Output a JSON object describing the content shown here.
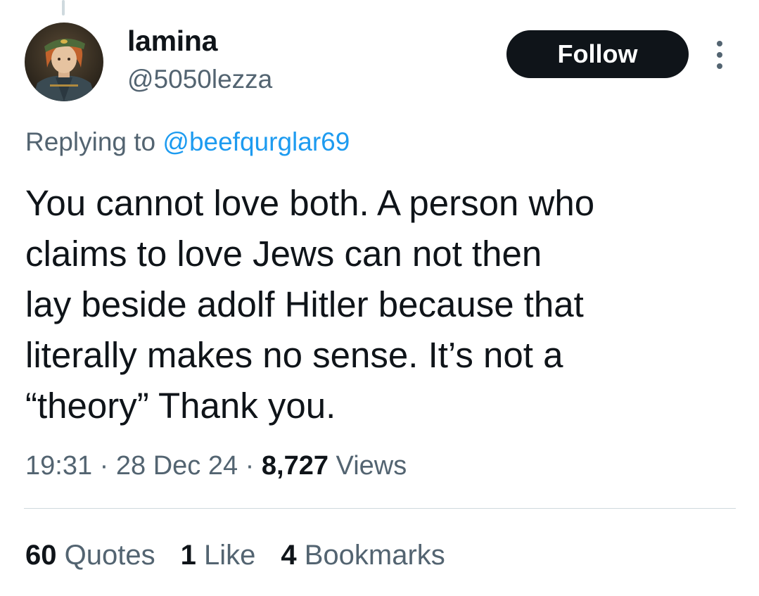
{
  "author": {
    "display_name": "lamina",
    "handle": "@5050lezza"
  },
  "follow_label": "Follow",
  "reply": {
    "prefix": "Replying to",
    "to_handle": "@beefqurglar69"
  },
  "tweet": {
    "lines": [
      "You cannot love both. A person who",
      "claims to love Jews can not then",
      "lay beside adolf Hitler because that",
      "literally makes no sense. It’s not a",
      "“theory” Thank you."
    ]
  },
  "meta": {
    "time": "19:31",
    "separator": "·",
    "date": "28 Dec 24",
    "views_count": "8,727",
    "views_label": "Views"
  },
  "stats": {
    "quotes_count": "60",
    "quotes_label": "Quotes",
    "likes_count": "1",
    "likes_label": "Like",
    "bookmarks_count": "4",
    "bookmarks_label": "Bookmarks"
  },
  "colors": {
    "text_primary": "#0f1419",
    "text_secondary": "#536471",
    "link": "#1d9bf0",
    "follow_bg": "#0f1419",
    "divider": "#cfd9de"
  },
  "icons": {
    "more": "more-vertical-icon"
  }
}
